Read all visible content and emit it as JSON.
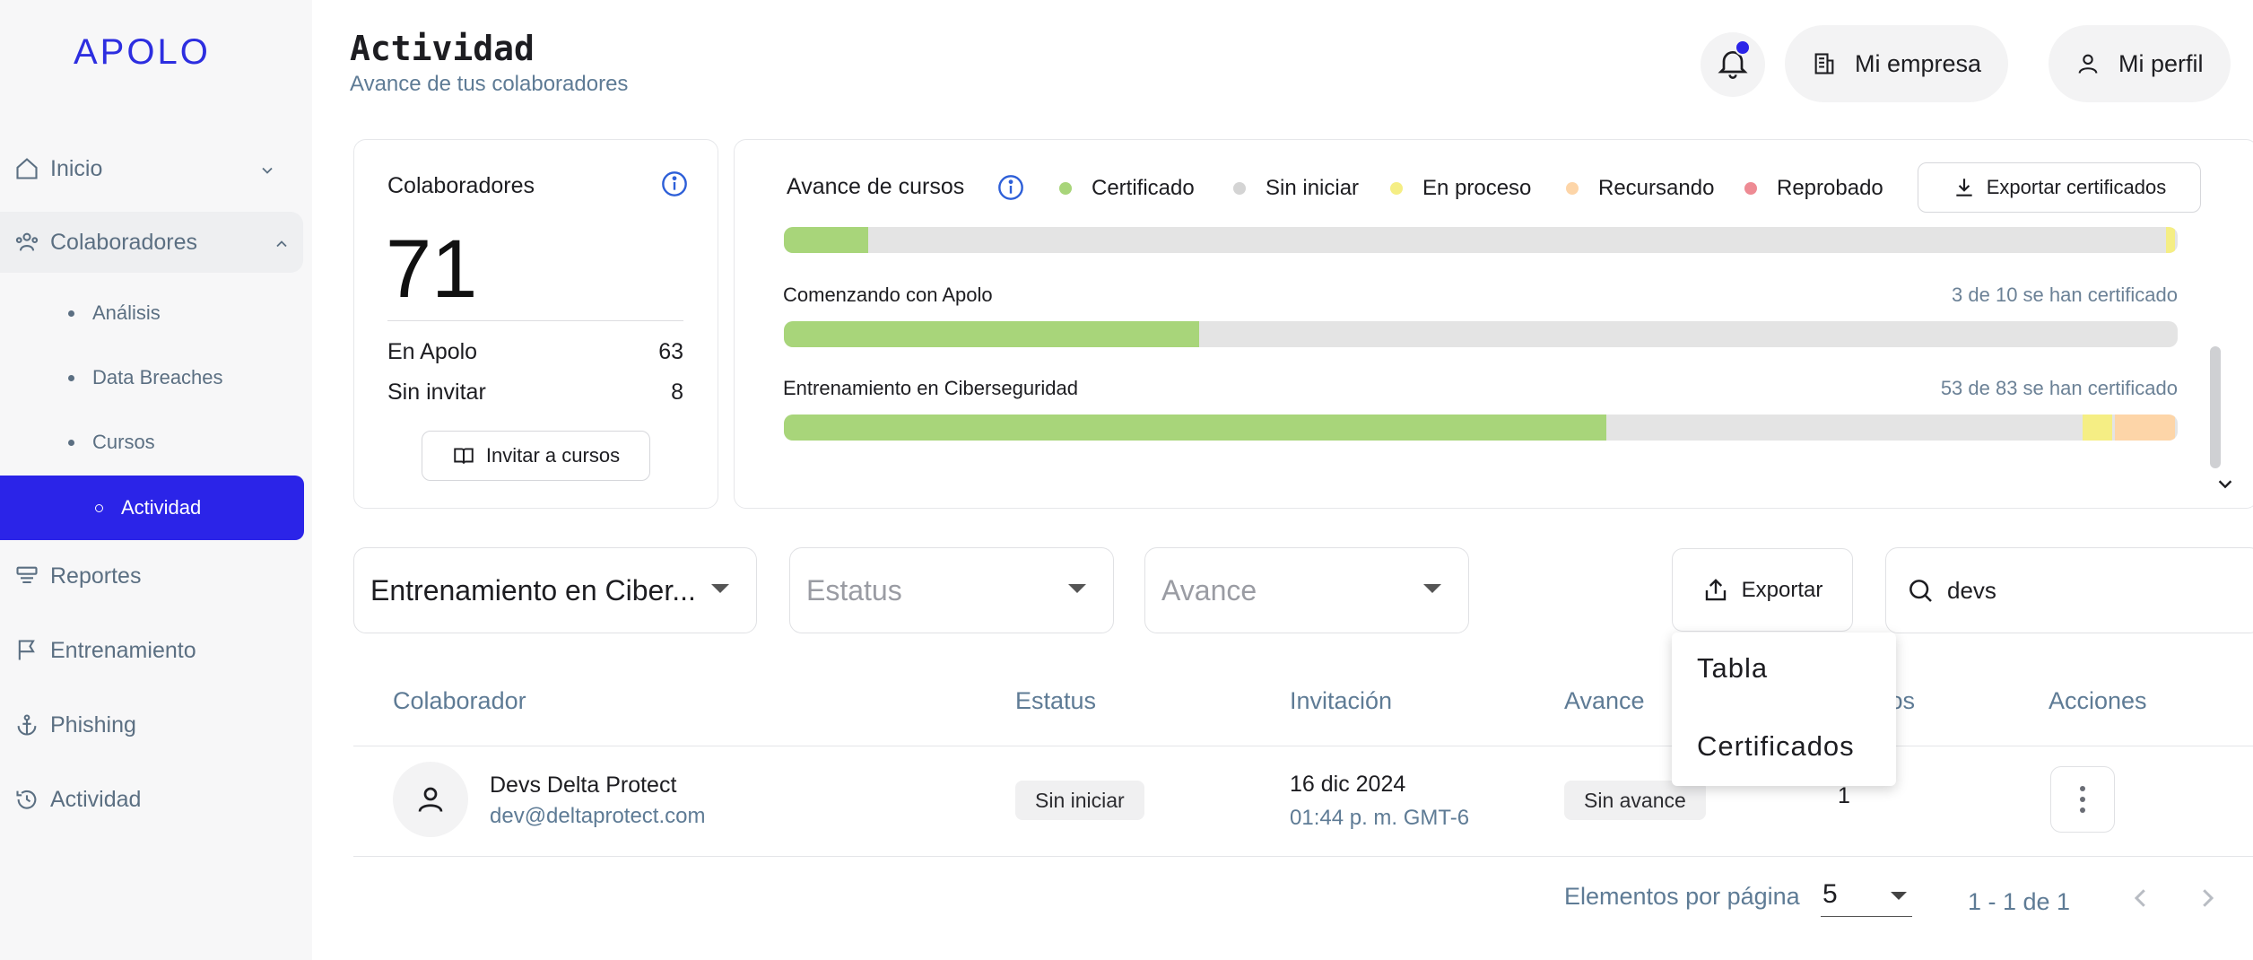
{
  "app": {
    "logo": "APOLO",
    "accent": "#2b24e8"
  },
  "sidebar": {
    "items": [
      {
        "label": "Inicio",
        "icon": "home-icon"
      },
      {
        "label": "Colaboradores",
        "icon": "users-icon"
      },
      {
        "label": "Reportes",
        "icon": "reports-icon"
      },
      {
        "label": "Entrenamiento",
        "icon": "flag-icon"
      },
      {
        "label": "Phishing",
        "icon": "anchor-icon"
      },
      {
        "label": "Actividad",
        "icon": "history-icon"
      }
    ],
    "sub_items": [
      {
        "label": "Análisis"
      },
      {
        "label": "Data Breaches"
      },
      {
        "label": "Cursos"
      },
      {
        "label": "Actividad"
      }
    ]
  },
  "header": {
    "title": "Actividad",
    "subtitle": "Avance de tus colaboradores",
    "company_label": "Mi empresa",
    "profile_label": "Mi perfil"
  },
  "collaborators_card": {
    "title": "Colaboradores",
    "total": "71",
    "rows": [
      {
        "label": "En Apolo",
        "value": "63"
      },
      {
        "label": "Sin invitar",
        "value": "8"
      }
    ],
    "invite_label": "Invitar a cursos"
  },
  "courses_card": {
    "title": "Avance de cursos",
    "legend": [
      {
        "label": "Certificado",
        "color": "#a8d57a"
      },
      {
        "label": "Sin iniciar",
        "color": "#d4d4d4"
      },
      {
        "label": "En proceso",
        "color": "#f5ee84"
      },
      {
        "label": "Recursando",
        "color": "#fdd5a8"
      },
      {
        "label": "Reprobado",
        "color": "#ee8b94"
      }
    ],
    "export_label": "Exportar certificados",
    "courses": [
      {
        "name": "",
        "stat": "",
        "certified_frac": 0.0627,
        "in_process_frac": 0.0085,
        "retaking_frac": 0
      },
      {
        "name": "Comenzando con Apolo",
        "stat": "3 de 10 se han certificado",
        "certified_frac": 0.3,
        "in_process_frac": 0,
        "retaking_frac": 0
      },
      {
        "name": "Entrenamiento en Ciberseguridad",
        "stat": "53 de 83 se han certificado",
        "certified_frac": 0.5917,
        "in_process_frac": 0.0232,
        "retaking_frac": 0.0451
      }
    ]
  },
  "filters": {
    "course_value": "Entrenamiento en Ciber...",
    "status_placeholder": "Estatus",
    "progress_placeholder": "Avance",
    "export_label": "Exportar",
    "search_value": "devs"
  },
  "export_menu": {
    "items": [
      "Tabla",
      "Certificados"
    ]
  },
  "table": {
    "headers": [
      "Colaborador",
      "Estatus",
      "Invitación",
      "Avance",
      "ntos",
      "Acciones"
    ],
    "rows": [
      {
        "name": "Devs Delta Protect",
        "email": "dev@deltaprotect.com",
        "status": "Sin iniciar",
        "invite_date": "16 dic 2024",
        "invite_time": "01:44 p. m. GMT-6",
        "progress": "Sin avance",
        "attempts": "1"
      }
    ]
  },
  "pagination": {
    "label": "Elementos por página",
    "per_page": "5",
    "range": "1 - 1 de 1"
  }
}
